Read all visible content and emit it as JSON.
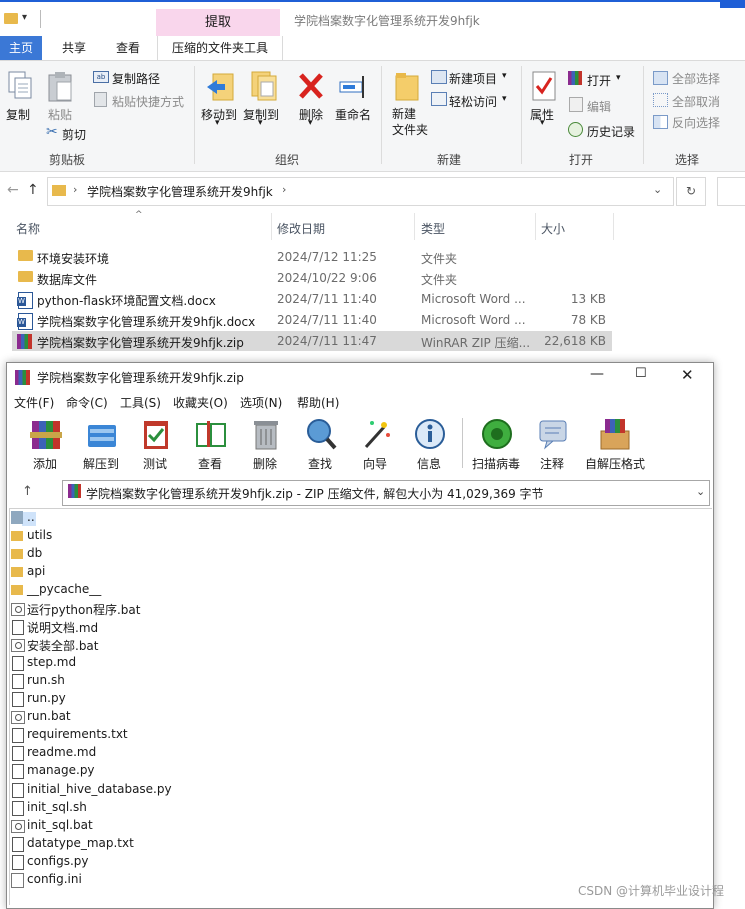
{
  "explorer": {
    "title": "学院档案数字化管理系统开发9hfjk",
    "context_tab": "提取",
    "tabs": [
      "主页",
      "共享",
      "查看",
      "压缩的文件夹工具"
    ],
    "ribbon": {
      "copy": "复制",
      "paste": "粘贴",
      "copy_path": "复制路径",
      "paste_shortcut": "粘贴快捷方式",
      "cut": "剪切",
      "move_to": "移动到",
      "copy_to": "复制到",
      "delete": "删除",
      "rename": "重命名",
      "new_folder": "新建\n文件夹",
      "new_item": "新建项目",
      "easy_access": "轻松访问",
      "properties": "属性",
      "open": "打开",
      "edit": "编辑",
      "history": "历史记录",
      "select_all": "全部选择",
      "select_none": "全部取消",
      "invert": "反向选择",
      "groups": [
        "剪贴板",
        "组织",
        "新建",
        "打开",
        "选择"
      ]
    },
    "breadcrumb": "学院档案数字化管理系统开发9hfjk",
    "columns": {
      "name": "名称",
      "date": "修改日期",
      "type": "类型",
      "size": "大小"
    },
    "files": [
      {
        "name": "环境安装环境",
        "date": "2024/7/12 11:25",
        "type": "文件夹",
        "size": "",
        "icon": "folder-icon"
      },
      {
        "name": "数据库文件",
        "date": "2024/10/22 9:06",
        "type": "文件夹",
        "size": "",
        "icon": "folder-icon"
      },
      {
        "name": "python-flask环境配置文档.docx",
        "date": "2024/7/11 11:40",
        "type": "Microsoft Word ...",
        "size": "13 KB",
        "icon": "word-icon"
      },
      {
        "name": "学院档案数字化管理系统开发9hfjk.docx",
        "date": "2024/7/11 11:40",
        "type": "Microsoft Word ...",
        "size": "78 KB",
        "icon": "word-icon"
      },
      {
        "name": "学院档案数字化管理系统开发9hfjk.zip",
        "date": "2024/7/11 11:47",
        "type": "WinRAR ZIP 压缩...",
        "size": "22,618 KB",
        "icon": "winrar-icon"
      }
    ]
  },
  "winrar": {
    "title": "学院档案数字化管理系统开发9hfjk.zip",
    "menu": [
      "文件(F)",
      "命令(C)",
      "工具(S)",
      "收藏夹(O)",
      "选项(N)",
      "帮助(H)"
    ],
    "toolbar": [
      "添加",
      "解压到",
      "测试",
      "查看",
      "删除",
      "查找",
      "向导",
      "信息",
      "扫描病毒",
      "注释",
      "自解压格式"
    ],
    "address": "学院档案数字化管理系统开发9hfjk.zip - ZIP 压缩文件, 解包大小为 41,029,369 字节",
    "items": [
      {
        "name": "..",
        "icon": "up"
      },
      {
        "name": "utils",
        "icon": "folder"
      },
      {
        "name": "db",
        "icon": "folder"
      },
      {
        "name": "api",
        "icon": "folder"
      },
      {
        "name": "__pycache__",
        "icon": "folder"
      },
      {
        "name": "运行python程序.bat",
        "icon": "bat"
      },
      {
        "name": "说明文档.md",
        "icon": "file"
      },
      {
        "name": "安装全部.bat",
        "icon": "bat"
      },
      {
        "name": "step.md",
        "icon": "file"
      },
      {
        "name": "run.sh",
        "icon": "file"
      },
      {
        "name": "run.py",
        "icon": "file"
      },
      {
        "name": "run.bat",
        "icon": "bat"
      },
      {
        "name": "requirements.txt",
        "icon": "file"
      },
      {
        "name": "readme.md",
        "icon": "file"
      },
      {
        "name": "manage.py",
        "icon": "file"
      },
      {
        "name": "initial_hive_database.py",
        "icon": "file"
      },
      {
        "name": "init_sql.sh",
        "icon": "file"
      },
      {
        "name": "init_sql.bat",
        "icon": "bat"
      },
      {
        "name": "datatype_map.txt",
        "icon": "file"
      },
      {
        "name": "configs.py",
        "icon": "file"
      },
      {
        "name": "config.ini",
        "icon": "ini"
      }
    ]
  },
  "watermark": "CSDN @计算机毕业设计程"
}
